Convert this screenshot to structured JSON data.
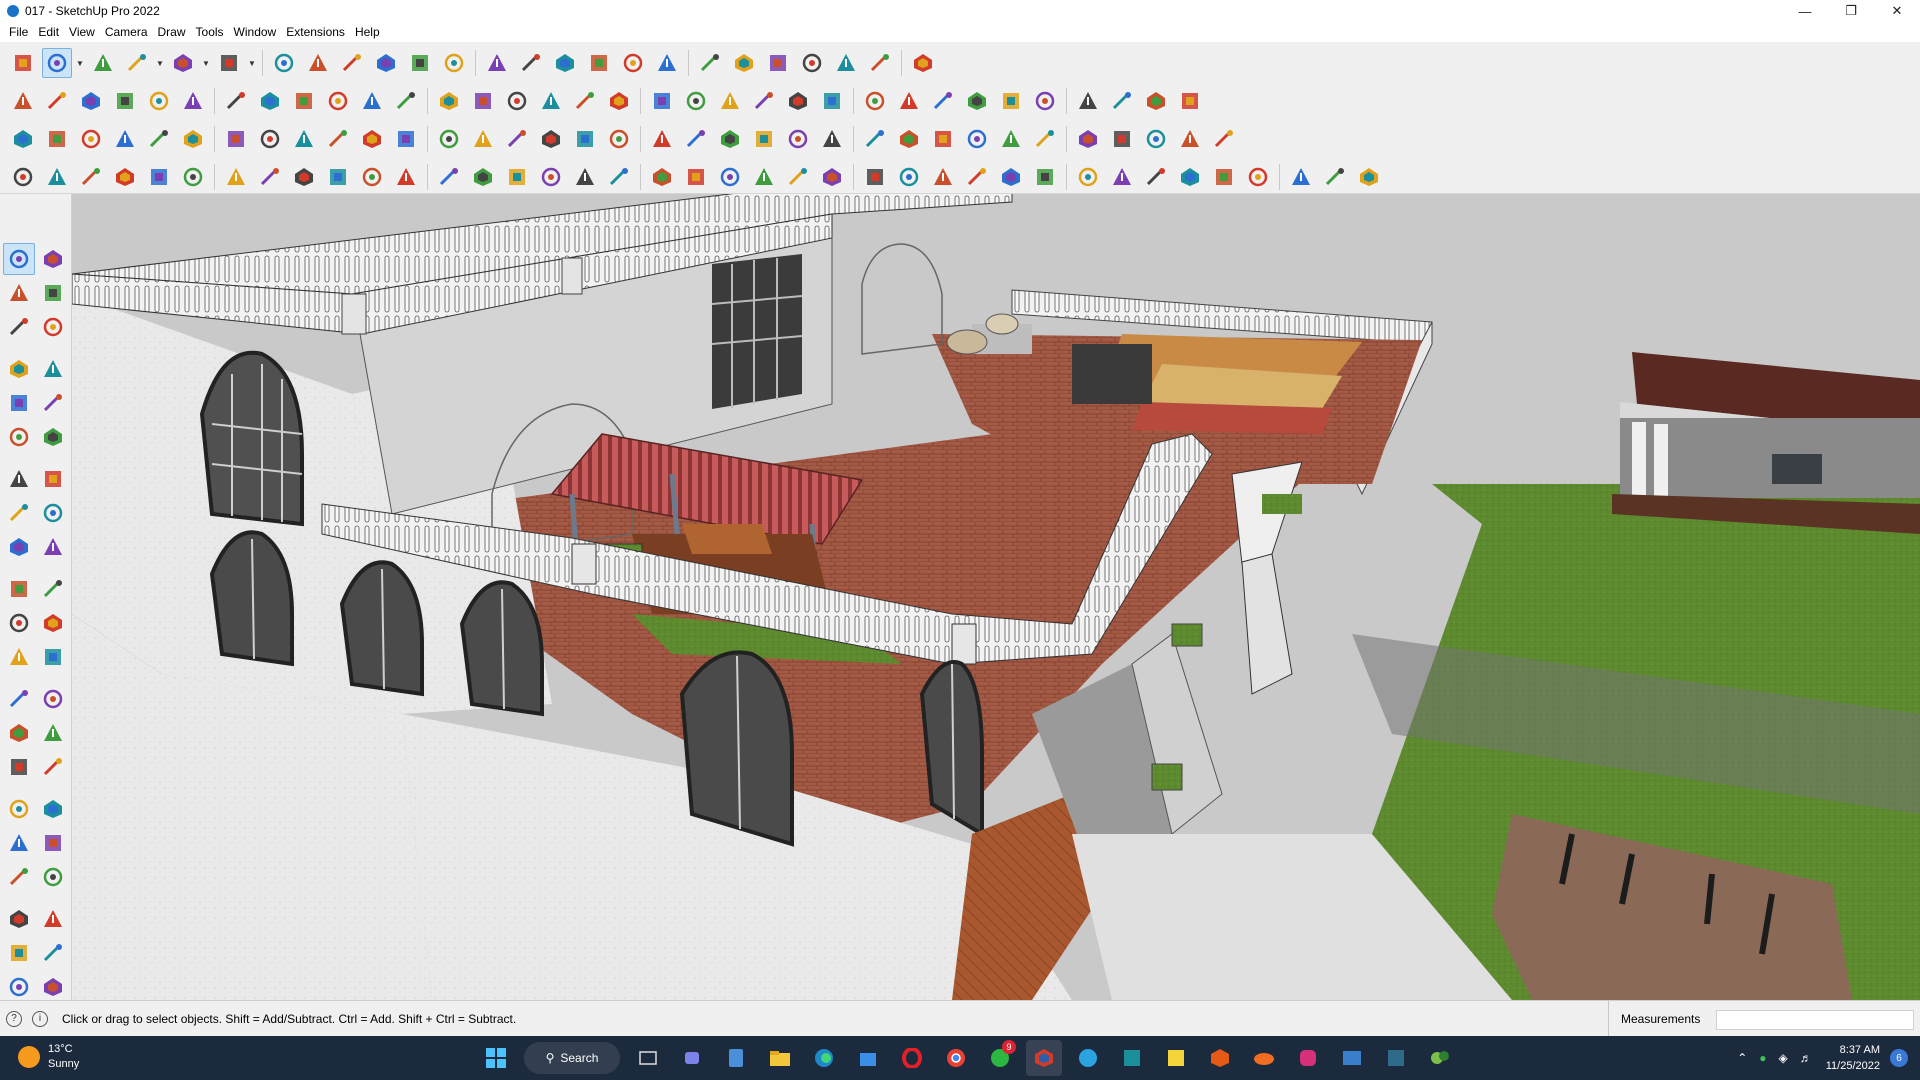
{
  "window": {
    "title": "017 - SketchUp Pro 2022",
    "minimize": "—",
    "maximize": "❐",
    "close": "✕"
  },
  "menu": [
    "File",
    "Edit",
    "View",
    "Camera",
    "Draw",
    "Tools",
    "Window",
    "Extensions",
    "Help"
  ],
  "toolbar_rows": [
    [
      "zoom-extents",
      "select",
      "eraser",
      "line",
      "arc",
      "rectangle",
      "push-pull",
      "follow-me",
      "move",
      "rotate",
      "scale",
      "tape-measure",
      "text",
      "paint-bucket",
      "orbit",
      "pan",
      "zoom",
      "zoom-window",
      "components",
      "styles",
      "layers",
      "outliner",
      "warehouse",
      "extension-warehouse",
      "layout"
    ],
    [
      "iso-view",
      "top-view",
      "front-view",
      "right-view",
      "back-view",
      "left-view",
      "xray",
      "back-edges",
      "wireframe",
      "hidden-line",
      "shaded",
      "textured",
      "monochrome",
      "section-plane",
      "section-display",
      "section-cut",
      "sandbox-contours",
      "sandbox-scratch",
      "smoove",
      "stamp",
      "drape",
      "add-detail",
      "flip-edge",
      "solid-outer-shell",
      "solid-intersect",
      "solid-union",
      "solid-subtract",
      "solid-trim",
      "solid-split",
      "dimension",
      "protractor",
      "axes",
      "3d-text",
      "export"
    ],
    [
      "select-2",
      "move-2",
      "rotate-2",
      "scale-2",
      "offset",
      "arc-2pt",
      "arc-3pt",
      "pie",
      "circle",
      "polygon",
      "freehand",
      "bezier",
      "spline",
      "fillet",
      "chamfer",
      "extend",
      "trim",
      "join",
      "weld",
      "split",
      "intersect",
      "divide",
      "array",
      "mirror",
      "align",
      "stretch",
      "explode",
      "group",
      "component",
      "paint",
      "uv",
      "material",
      "camera",
      "sun",
      "shadow"
    ],
    [
      "plane-blue",
      "plane-blue-2",
      "plane-yellow",
      "plane-green",
      "plane-red",
      "plane-white",
      "rotate-tool",
      "stop",
      "list",
      "flag",
      "box",
      "chain",
      "hook",
      "curve",
      "cross-red",
      "cross-green",
      "cross-blue",
      "cone",
      "cone-2",
      "warning",
      "lasso",
      "lasso-2",
      "loop",
      "move-point",
      "bucket",
      "undo-red",
      "tree",
      "gear",
      "gear-2",
      "gear-3",
      "gem",
      "grid",
      "frame",
      "tile",
      "tile-2",
      "tile-3",
      "nodes",
      "dots",
      "grid-2"
    ]
  ],
  "left_tools": [
    "select",
    "orbit",
    "paint",
    "eraser",
    "component",
    "pencil",
    "line",
    "freehand",
    "rectangle",
    "rotated-rect",
    "circle",
    "polygon",
    "arc",
    "arc-2",
    "arc-3",
    "pie",
    "move",
    "push-pull",
    "rotate",
    "follow-me",
    "scale",
    "offset",
    "tape",
    "text",
    "protractor",
    "dimension",
    "axes",
    "3d-text",
    "orbit-2",
    "pan",
    "zoom",
    "zoom-window",
    "zoom-extents",
    "prev-view",
    "walk",
    "look-around",
    "footprints",
    "position-camera",
    "section",
    "section-2",
    "layers-2",
    "styles-2"
  ],
  "status": {
    "hint": "Click or drag to select objects. Shift = Add/Subtract. Ctrl = Add. Shift + Ctrl = Subtract.",
    "measurements_label": "Measurements",
    "measurements_value": ""
  },
  "taskbar": {
    "temperature": "13°C",
    "weather": "Sunny",
    "search_label": "Search",
    "whatsapp_badge": "9",
    "time": "8:37 AM",
    "date": "11/25/2022",
    "notifications": "6"
  },
  "colors": {
    "sky": "#c9c9c9",
    "lawn": "#5d8a2e",
    "terrace_floor": "#a5533b",
    "pergola": "#b8484a",
    "wall": "#e6e6e6",
    "taskbar": "#1c2a3d"
  }
}
